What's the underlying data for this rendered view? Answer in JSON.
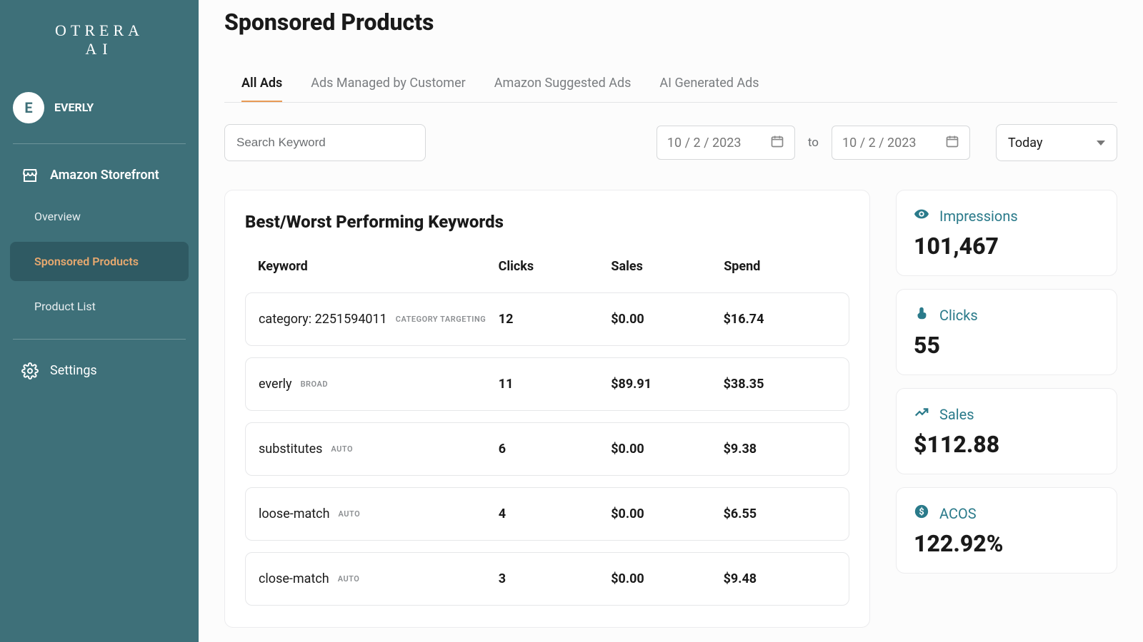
{
  "brand": {
    "line1": "OTRERA",
    "line2": "AI"
  },
  "user": {
    "initial": "E",
    "name": "EVERLY"
  },
  "nav": {
    "storefront": "Amazon Storefront",
    "overview": "Overview",
    "sponsored": "Sponsored Products",
    "productList": "Product List",
    "settings": "Settings"
  },
  "page": {
    "title": "Sponsored Products"
  },
  "tabs": [
    "All Ads",
    "Ads Managed by Customer",
    "Amazon Suggested Ads",
    "AI Generated Ads"
  ],
  "search": {
    "placeholder": "Search Keyword"
  },
  "dateRange": {
    "from": "10 / 2 / 2023",
    "toLabel": "to",
    "to": "10 / 2 / 2023"
  },
  "period": {
    "selected": "Today"
  },
  "tableCard": {
    "title": "Best/Worst Performing Keywords",
    "columns": {
      "keyword": "Keyword",
      "clicks": "Clicks",
      "sales": "Sales",
      "spend": "Spend"
    },
    "rows": [
      {
        "keyword": "category: 2251594011",
        "badge": "CATEGORY TARGETING",
        "clicks": "12",
        "sales": "$0.00",
        "spend": "$16.74"
      },
      {
        "keyword": "everly",
        "badge": "BROAD",
        "clicks": "11",
        "sales": "$89.91",
        "spend": "$38.35"
      },
      {
        "keyword": "substitutes",
        "badge": "AUTO",
        "clicks": "6",
        "sales": "$0.00",
        "spend": "$9.38"
      },
      {
        "keyword": "loose-match",
        "badge": "AUTO",
        "clicks": "4",
        "sales": "$0.00",
        "spend": "$6.55"
      },
      {
        "keyword": "close-match",
        "badge": "AUTO",
        "clicks": "3",
        "sales": "$0.00",
        "spend": "$9.48"
      }
    ]
  },
  "stats": {
    "impressions": {
      "label": "Impressions",
      "value": "101,467"
    },
    "clicks": {
      "label": "Clicks",
      "value": "55"
    },
    "sales": {
      "label": "Sales",
      "value": "$112.88"
    },
    "acos": {
      "label": "ACOS",
      "value": "122.92%"
    }
  }
}
